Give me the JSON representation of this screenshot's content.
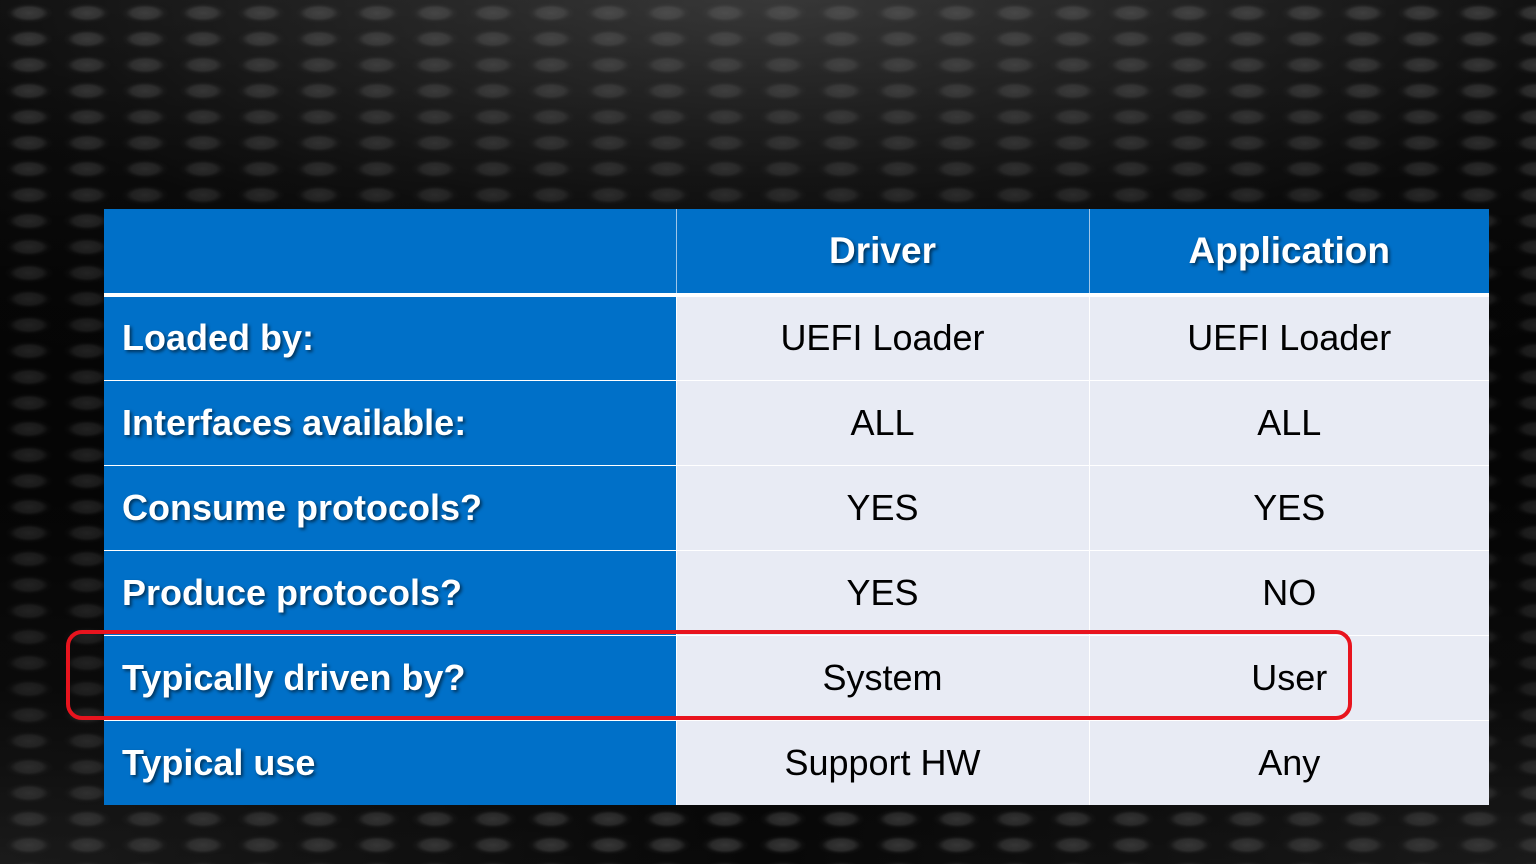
{
  "table": {
    "headers": [
      "",
      "Driver",
      "Application"
    ],
    "rows": [
      {
        "label": "Loaded by:",
        "driver": "UEFI Loader",
        "application": "UEFI Loader"
      },
      {
        "label": "Interfaces available:",
        "driver": "ALL",
        "application": "ALL"
      },
      {
        "label": "Consume protocols?",
        "driver": "YES",
        "application": "YES"
      },
      {
        "label": "Produce protocols?",
        "driver": "YES",
        "application": "NO"
      },
      {
        "label": "Typically driven by?",
        "driver": "System",
        "application": "User"
      },
      {
        "label": "Typical use",
        "driver": "Support HW",
        "application": "Any"
      }
    ]
  },
  "highlight": {
    "row_index": 4,
    "color": "#e8141e"
  },
  "colors": {
    "header_blue": "#0070c8",
    "cell_bg": "#e8ebf4"
  }
}
